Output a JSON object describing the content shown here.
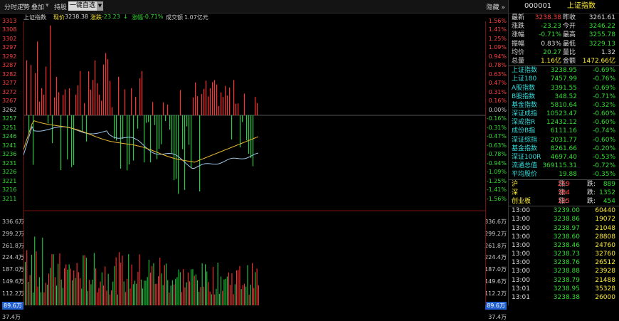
{
  "toolbar": {
    "tab_timeline": "分时走势",
    "tab_overlay": "叠加",
    "tab_options": "持股",
    "period_select": "一键自选",
    "collapse": "隐藏"
  },
  "info": {
    "index_name": "上证指数",
    "price_label": "现价",
    "price": "3238.38",
    "change_label": "涨跌",
    "change": "-23.23",
    "pct_label": "涨幅",
    "pct": "-0.71%",
    "volume_label": "成交额",
    "volume": "1.07亿元"
  },
  "axis_left_price": [
    "3313",
    "3308",
    "3302",
    "3297",
    "3292",
    "3287",
    "3282",
    "3277",
    "3272",
    "3267",
    "3262",
    "3257",
    "3251",
    "3246",
    "3241",
    "3236",
    "3231",
    "3226",
    "3221",
    "3216",
    "3211"
  ],
  "axis_right_pct": [
    "1.56%",
    "1.41%",
    "1.25%",
    "1.09%",
    "0.94%",
    "0.78%",
    "0.63%",
    "0.47%",
    "0.31%",
    "0.16%",
    "0.00%",
    "-0.16%",
    "-0.31%",
    "-0.47%",
    "-0.63%",
    "-0.78%",
    "-0.94%",
    "-1.09%",
    "-1.25%",
    "-1.41%",
    "-1.56%"
  ],
  "axis_volume": [
    "336.6万",
    "299.2万",
    "261.8万",
    "224.4万",
    "187.0万",
    "149.6万",
    "112.2万",
    "89.6万",
    "37.4万"
  ],
  "panel": {
    "code": "000001",
    "name": "上证指数",
    "quote_rows": [
      {
        "l1": "最新",
        "v1": "3238.38",
        "l2": "昨收",
        "v2": "3261.61",
        "c1": "#ff4040",
        "c2": "#dddddd"
      },
      {
        "l1": "涨跌",
        "v1": "-23.23",
        "l2": "今开",
        "v2": "3246.22",
        "c1": "#33dd33",
        "c2": "#33dd33"
      },
      {
        "l1": "涨幅",
        "v1": "-0.71%",
        "l2": "最高",
        "v2": "3255.78",
        "c1": "#33dd33",
        "c2": "#33dd33"
      },
      {
        "l1": "振幅",
        "v1": "0.83%",
        "l2": "最低",
        "v2": "3229.13",
        "c1": "#dddddd",
        "c2": "#33dd33"
      },
      {
        "l1": "均价",
        "v1": "20.27",
        "l2": "量比",
        "v2": "1.32",
        "c1": "#33dd33",
        "c2": "#dddddd"
      },
      {
        "l1": "总量",
        "v1": "1.16亿",
        "l2": "金额",
        "v2": "1472.66亿",
        "c1": "#ffee33",
        "c2": "#ffee33"
      }
    ],
    "index_rows": [
      {
        "name": "上证指数",
        "value": "3238.95",
        "pct": "-0.69%"
      },
      {
        "name": "上证180",
        "value": "7457.99",
        "pct": "-0.76%"
      },
      {
        "name": "A股指数",
        "value": "3391.55",
        "pct": "-0.69%"
      },
      {
        "name": "B股指数",
        "value": "348.52",
        "pct": "-0.71%"
      },
      {
        "name": "基金指数",
        "value": "5810.64",
        "pct": "-0.32%"
      },
      {
        "name": "深证成指",
        "value": "10523.47",
        "pct": "-0.60%"
      },
      {
        "name": "深成指R",
        "value": "12432.12",
        "pct": "-0.60%"
      },
      {
        "name": "成份B指",
        "value": "6111.16",
        "pct": "-0.74%"
      },
      {
        "name": "深证综指",
        "value": "2031.77",
        "pct": "-0.60%"
      },
      {
        "name": "基金指数",
        "value": "8261.66",
        "pct": "-0.20%"
      },
      {
        "name": "深证100R",
        "value": "4697.40",
        "pct": "-0.53%"
      },
      {
        "name": "流通总值",
        "value": "369115.31",
        "pct": "-0.72%"
      },
      {
        "name": "平均股价",
        "value": "19.88",
        "pct": "-0.35%"
      }
    ],
    "breadth_rows": [
      {
        "name": "沪",
        "up_label": "涨:",
        "up": "259",
        "down_label": "跌:",
        "down": "889"
      },
      {
        "name": "深",
        "up_label": "涨:",
        "up": "384",
        "down_label": "跌:",
        "down": "1352"
      },
      {
        "name": "创业板",
        "up_label": "涨:",
        "up": "105",
        "down_label": "跌:",
        "down": "454"
      }
    ],
    "ticks": [
      {
        "time": "13:00",
        "price": "3239.00",
        "vol": "60440"
      },
      {
        "time": "13:00",
        "price": "3238.86",
        "vol": "19072"
      },
      {
        "time": "13:00",
        "price": "3238.97",
        "vol": "21048"
      },
      {
        "time": "13:00",
        "price": "3238.60",
        "vol": "28808"
      },
      {
        "time": "13:00",
        "price": "3238.46",
        "vol": "24760"
      },
      {
        "time": "13:00",
        "price": "3238.73",
        "vol": "32760"
      },
      {
        "time": "13:00",
        "price": "3238.76",
        "vol": "26512"
      },
      {
        "time": "13:00",
        "price": "3238.88",
        "vol": "23928"
      },
      {
        "time": "13:00",
        "price": "3238.79",
        "vol": "21488"
      },
      {
        "time": "13:01",
        "price": "3238.95",
        "vol": "35328"
      },
      {
        "time": "13:01",
        "price": "3238.38",
        "vol": "26000"
      }
    ]
  },
  "colors": {
    "up": "#ff3030",
    "down": "#22cc44",
    "yellow": "#ffee33",
    "cyan": "#33dddd"
  }
}
